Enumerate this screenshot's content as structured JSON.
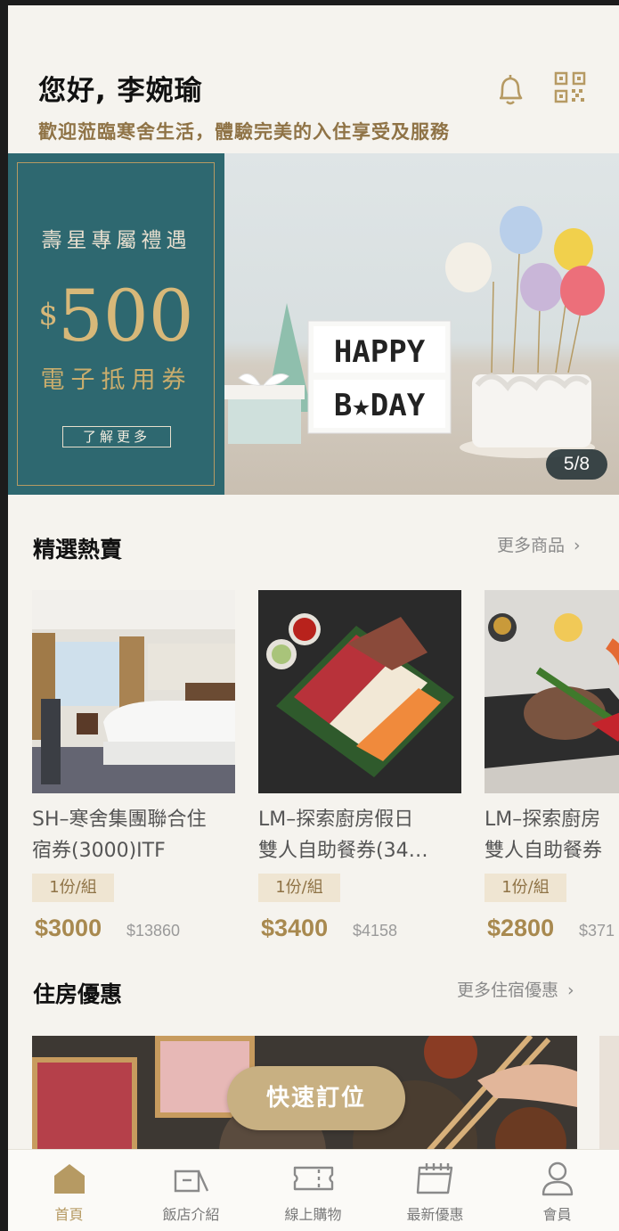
{
  "header": {
    "greeting": "您好, 李婉瑜",
    "welcome": "歡迎蒞臨寒舍生活，體驗完美的入住享受及服務"
  },
  "banner": {
    "promo_title": "壽星專屬禮遇",
    "currency": "$",
    "amount": "500",
    "promo_subtitle": "電子抵用券",
    "promo_button": "了解更多",
    "photo_sign_line1": "HAPPY",
    "photo_sign_line2": "B★DAY",
    "counter": "5/8"
  },
  "featured": {
    "title": "精選熱賣",
    "more": "更多商品",
    "items": [
      {
        "name_line1": "SH–寒舍集團聯合住",
        "name_line2": "宿券(3000)ITF",
        "unit": "1份/組",
        "price": "$3000",
        "original": "$13860"
      },
      {
        "name_line1": "LM–探索廚房假日",
        "name_line2": "雙人自助餐券(34…",
        "unit": "1份/組",
        "price": "$3400",
        "original": "$4158"
      },
      {
        "name_line1": "LM–探索廚房",
        "name_line2": "雙人自助餐券",
        "unit": "1份/組",
        "price": "$2800",
        "original": "$371"
      }
    ]
  },
  "lodging": {
    "title": "住房優惠",
    "more": "更多住宿優惠"
  },
  "quick_booking": "快速訂位",
  "tabbar": {
    "items": [
      {
        "label": "首頁",
        "icon": "home-icon"
      },
      {
        "label": "飯店介紹",
        "icon": "hotel-icon"
      },
      {
        "label": "線上購物",
        "icon": "ticket-icon"
      },
      {
        "label": "最新優惠",
        "icon": "calendar-icon"
      },
      {
        "label": "會員",
        "icon": "user-icon"
      }
    ],
    "active_color": "#b69a63",
    "inactive_color": "#7a7a7a"
  },
  "colors": {
    "accent_gold": "#b69a63",
    "promo_teal": "#2e6870",
    "background": "#f5f3ee"
  }
}
